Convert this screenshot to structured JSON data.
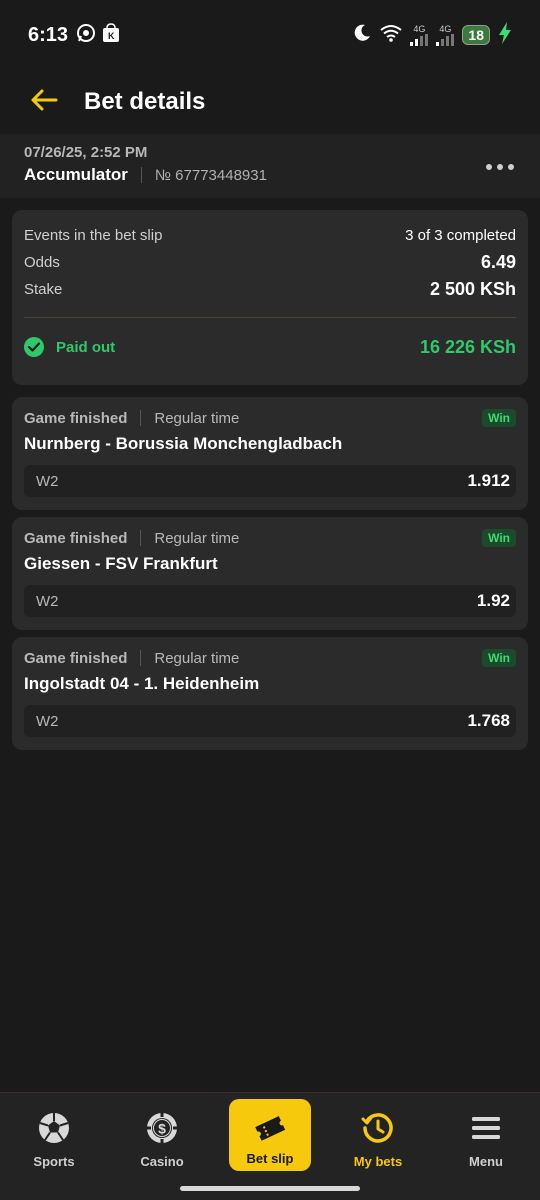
{
  "status_bar": {
    "time": "6:13",
    "signal_1": "4G",
    "signal_2": "4G",
    "battery": "18"
  },
  "header": {
    "title": "Bet details",
    "back_icon": "arrow-left-icon",
    "accent_color": "#f7c90d"
  },
  "bet": {
    "date": "07/26/25, 2:52 PM",
    "type": "Accumulator",
    "number": "№ 67773448931"
  },
  "summary": {
    "events_label": "Events in the bet slip",
    "events_value": "3 of 3 completed",
    "odds_label": "Odds",
    "odds_value": "6.49",
    "stake_label": "Stake",
    "stake_value": "2 500 KSh",
    "paid_label": "Paid out",
    "paid_amount": "16 226 KSh",
    "paid_color": "#2fc96a"
  },
  "events": [
    {
      "status": "Game finished",
      "period": "Regular time",
      "result": "Win",
      "name": "Nurnberg - Borussia Monchengladbach",
      "pick": "W2",
      "odds": "1.912"
    },
    {
      "status": "Game finished",
      "period": "Regular time",
      "result": "Win",
      "name": "Giessen - FSV Frankfurt",
      "pick": "W2",
      "odds": "1.92"
    },
    {
      "status": "Game finished",
      "period": "Regular time",
      "result": "Win",
      "name": "Ingolstadt 04 - 1. Heidenheim",
      "pick": "W2",
      "odds": "1.768"
    }
  ],
  "nav": {
    "sports": "Sports",
    "casino": "Casino",
    "bet_slip": "Bet slip",
    "my_bets": "My bets",
    "menu": "Menu",
    "active": "my_bets"
  }
}
